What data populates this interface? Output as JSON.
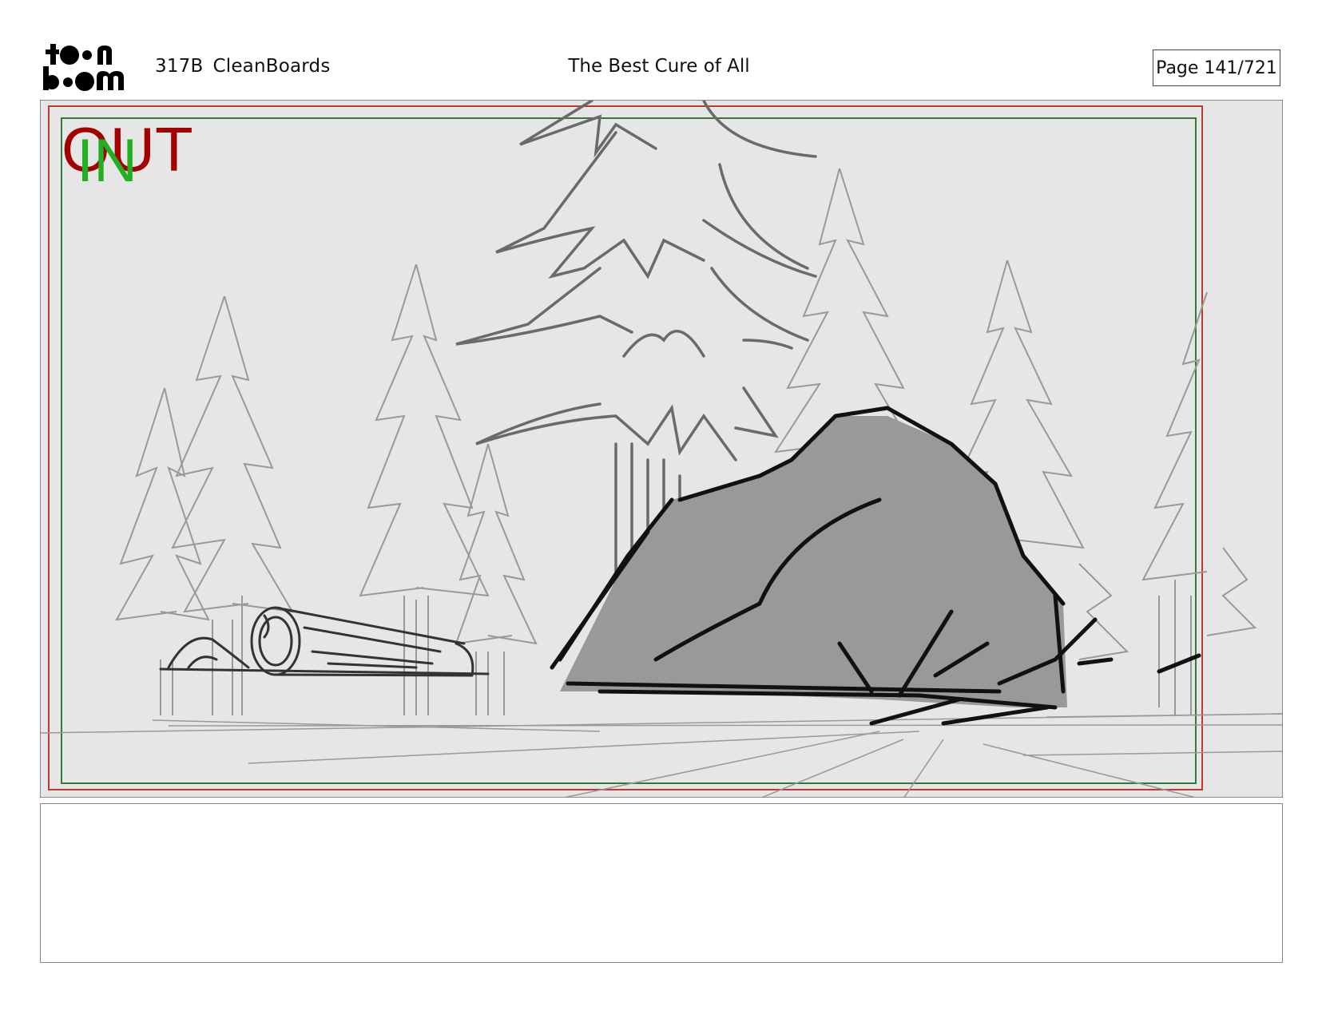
{
  "header": {
    "logo_top": "toon",
    "logo_bottom": "boom",
    "episode": "317B",
    "board_name": "CleanBoards",
    "title": "The Best Cure of All",
    "page": "Page 141/721"
  },
  "panel": {
    "out_label": "OUT",
    "in_label": "IN",
    "out_color": "#a30000",
    "in_color": "#21b021",
    "background_color": "#e6e6e6",
    "rock_fill": "#999999"
  },
  "notes": {
    "text": ""
  }
}
